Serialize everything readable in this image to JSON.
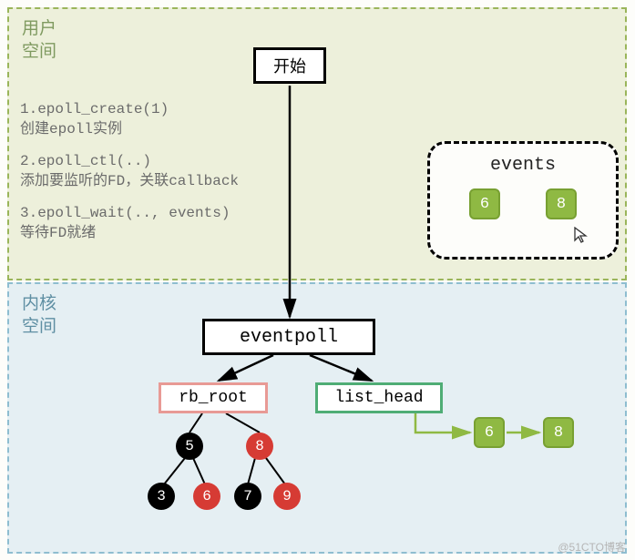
{
  "user_space": {
    "label": "用户\n空间"
  },
  "kernel_space": {
    "label": "内核\n空间"
  },
  "start": {
    "label": "开始"
  },
  "steps": [
    {
      "code": "1.epoll_create(1)",
      "desc": "创建epoll实例"
    },
    {
      "code": "2.epoll_ctl(..)",
      "desc": "添加要监听的FD，关联callback"
    },
    {
      "code": "3.epoll_wait(.., events)",
      "desc": "等待FD就绪"
    }
  ],
  "events": {
    "title": "events",
    "items": [
      "6",
      "8"
    ]
  },
  "eventpoll": {
    "label": "eventpoll"
  },
  "rb_root": {
    "label": "rb_root"
  },
  "list_head": {
    "label": "list_head"
  },
  "tree": {
    "n5": "5",
    "n8": "8",
    "n3": "3",
    "n6": "6",
    "n7": "7",
    "n9": "9"
  },
  "ready_list": [
    "6",
    "8"
  ],
  "colors": {
    "user_border": "#9ab55a",
    "user_bg": "#edf0db",
    "kernel_border": "#8ebdd0",
    "kernel_bg": "#e5eff3",
    "green_chip": "#8fb943",
    "rb_border": "#e89a95",
    "lh_border": "#4fad75",
    "red_node": "#d63b34",
    "black_node": "#000000"
  },
  "watermark": "@51CTO博客"
}
